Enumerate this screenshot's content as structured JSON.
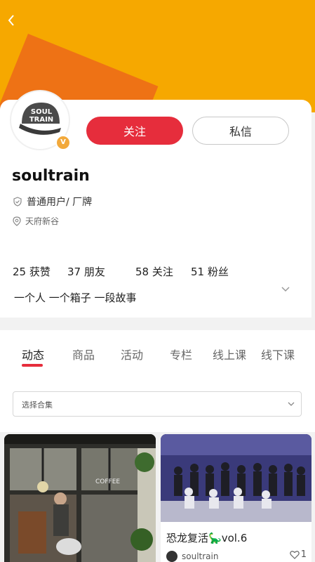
{
  "header": {
    "back_icon": "chevron-left-icon",
    "banner_color": "#f6a800",
    "banner_accent": "#ee7215"
  },
  "profile": {
    "avatar_text": "SOUL TRAIN",
    "verified_badge": "V",
    "follow_label": "关注",
    "message_label": "私信",
    "username": "soultrain",
    "user_type": "普通用户/ 厂牌",
    "location": "天府新谷",
    "accent_color": "#e62d3c"
  },
  "stats": {
    "likes_count": "25",
    "likes_label": "获赞",
    "friends_count": "37",
    "friends_label": "朋友",
    "following_count": "58",
    "following_label": "关注",
    "fans_count": "51",
    "fans_label": "粉丝"
  },
  "bio": "一个人 一个箱子 一段故事",
  "tabs": [
    {
      "label": "动态",
      "active": true
    },
    {
      "label": "商品"
    },
    {
      "label": "活动"
    },
    {
      "label": "专栏"
    },
    {
      "label": "线上课"
    },
    {
      "label": "线下课"
    }
  ],
  "filter": {
    "placeholder": "选择合集"
  },
  "posts": [
    {
      "image": "cafe-storefront-photo",
      "sign_text": "COFFEE"
    },
    {
      "image": "group-dance-photo",
      "title": "恐龙复活",
      "title_emoji": "🦕",
      "title_suffix": "vol.6",
      "author": "soultrain",
      "likes": "1"
    }
  ]
}
